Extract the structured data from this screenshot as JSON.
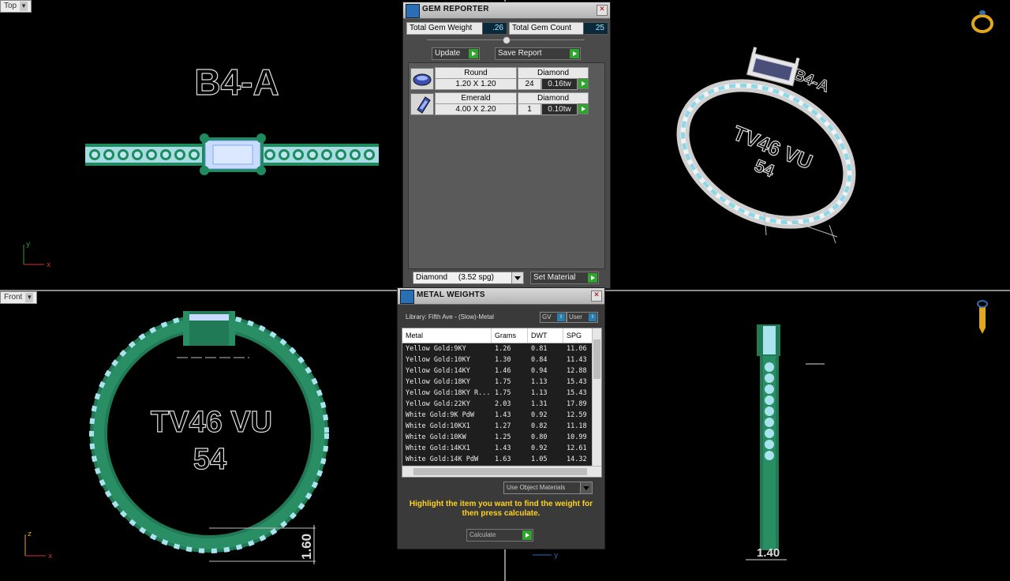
{
  "viewports": {
    "top": {
      "label": "Top",
      "band_text": "B4-A"
    },
    "front": {
      "label": "Front",
      "text_line1": "TV46 VU",
      "text_line2": "54",
      "dimension": "1.60"
    },
    "perspective": {
      "band_text": "B4-A",
      "text_line1": "TV46 VU",
      "text_line2": "54"
    },
    "side": {
      "dimension": "1.40"
    },
    "axes": {
      "x": "x",
      "y": "y",
      "z": "z"
    }
  },
  "gem_reporter": {
    "title": "GEM REPORTER",
    "total_weight_label": "Total Gem Weight",
    "total_weight_value": ".26",
    "total_count_label": "Total Gem Count",
    "total_count_value": "25",
    "update_label": "Update",
    "save_report_label": "Save Report",
    "gems": [
      {
        "shape": "Round",
        "size": "1.20 X 1.20",
        "material": "Diamond",
        "count": "24",
        "weight": "0.16tw"
      },
      {
        "shape": "Emerald",
        "size": "4.00 X 2.20",
        "material": "Diamond",
        "count": "1",
        "weight": "0.10tw"
      }
    ],
    "material_select": "Diamond     (3.52 spg)",
    "set_material_label": "Set Material"
  },
  "metal_weights": {
    "title": "METAL WEIGHTS",
    "library": "Library: Fifth Ave - (Slow)-Metal",
    "gv_label": "GV",
    "user_label": "User",
    "columns": [
      "Metal",
      "Grams",
      "DWT",
      "SPG"
    ],
    "rows": [
      [
        "Yellow Gold:9KY",
        "1.26",
        "0.81",
        "11.06"
      ],
      [
        "Yellow Gold:10KY",
        "1.30",
        "0.84",
        "11.43"
      ],
      [
        "Yellow Gold:14KY",
        "1.46",
        "0.94",
        "12.88"
      ],
      [
        "Yellow Gold:18KY",
        "1.75",
        "1.13",
        "15.43"
      ],
      [
        "Yellow Gold:18KY R...",
        "1.75",
        "1.13",
        "15.43"
      ],
      [
        "Yellow Gold:22KY",
        "2.03",
        "1.31",
        "17.89"
      ],
      [
        "White Gold:9K PdW",
        "1.43",
        "0.92",
        "12.59"
      ],
      [
        "White Gold:10KX1",
        "1.27",
        "0.82",
        "11.18"
      ],
      [
        "White Gold:10KW",
        "1.25",
        "0.80",
        "10.99"
      ],
      [
        "White Gold:14KX1",
        "1.43",
        "0.92",
        "12.61"
      ],
      [
        "White Gold:14K PdW",
        "1.63",
        "1.05",
        "14.32"
      ]
    ],
    "use_object_materials": "Use Object Materials",
    "hint": "Highlight the item you want to find the weight for then press calculate.",
    "calculate_label": "Calculate"
  }
}
